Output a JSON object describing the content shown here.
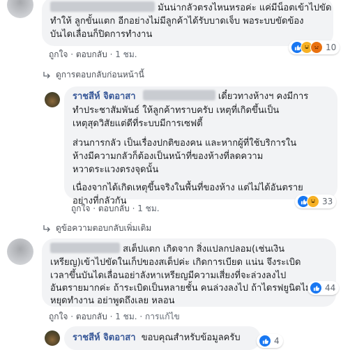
{
  "comment1": {
    "text_l1": "มันน่ากลัวตรงไหนหรอค่ะ แค่มีน็อตเข้าไปขัด",
    "text_l2": "ทำให้ ลูกขั้นแตก อีกอย่างไม่มีลูกค้าได้รับบาดเจ็บ พอระบบขัดข้อง",
    "text_l3": "บันไดเลื่อนก็ปิดการทำงาน",
    "like": "ถูกใจ",
    "reply": "ตอบกลับ",
    "time": "1 ชม.",
    "reaction_count": "10"
  },
  "view_previous_replies": "ดูการตอบกลับก่อนหน้านี้",
  "reply1": {
    "name": "ราชสีห์ จิตอาสา",
    "p1_l1": "เดี๋ยวทางห้างฯ คงมีการ",
    "p1_l2": "ทำประชาสัมพันธ์ ให้ลูกค้าทราบครับ เหตุที่เกิดขึ้นเป็น",
    "p1_l3": "เหตุสุดวิสัยแต่ดีที่ระบบมีการเซฟตี้",
    "p2_l1": "ส่วนการกลัว เป็นเรื่องปกติของคน และหากผู้ที่ใช้บริการใน",
    "p2_l2": "ห้างมีความกลัวก็ต้องเป็นหน้าที่ของห้างที่ลดความ",
    "p2_l3": "หวาดระแวงตรงจุดนั้น",
    "p3_l1": "เนื่องจากได้เกิดเหตุขึ้นจริงในพื้นที่ของห้าง แต่ไม่ได้อันตราย",
    "p3_l2": "อย่างที่กลัวกัน",
    "like": "ถูกใจ",
    "reply": "ตอบกลับ",
    "time": "1 ชม.",
    "reaction_count": "33"
  },
  "view_more_replies": "ดูข้อความตอบกลับเพิ่มเติม",
  "comment2": {
    "text_l1": "สเต็ปแตก เกิดจาก สิ่งแปลกปลอม(เช่นเงิน",
    "text_l2": "เหรียญ)เข้าไปขัดในเก็ปของสเต็ปค่ะ เกิดการเบียด แน่น จึงระเบิด",
    "text_l3": "เวลาขึ้นบันไดเลื่อนอย่าลังหาเหรียญมีความเสี่ยงที่จะล่วงลงไป",
    "text_l4": "อันตรายมากค่ะ ถ้าระเบิดเป็นหลายชั้น คนล่วงลงไป ถ้าไดรฟยูนิตไม่",
    "text_l5": "หยุดทำงาน อย่าพูดถึงเลย หลอน",
    "like": "ถูกใจ",
    "reply": "ตอบกลับ",
    "time": "1 ชม.",
    "edited": "การแก้ไข",
    "reaction_count": "44"
  },
  "reply2": {
    "name": "ราชสีห์ จิตอาสา",
    "text": "ขอบคุณสำหรับข้อมูลครับ",
    "reaction_count": "4"
  },
  "colors": {
    "link": "#385898",
    "bubble": "#f2f3f5",
    "like": "#1877f2"
  }
}
